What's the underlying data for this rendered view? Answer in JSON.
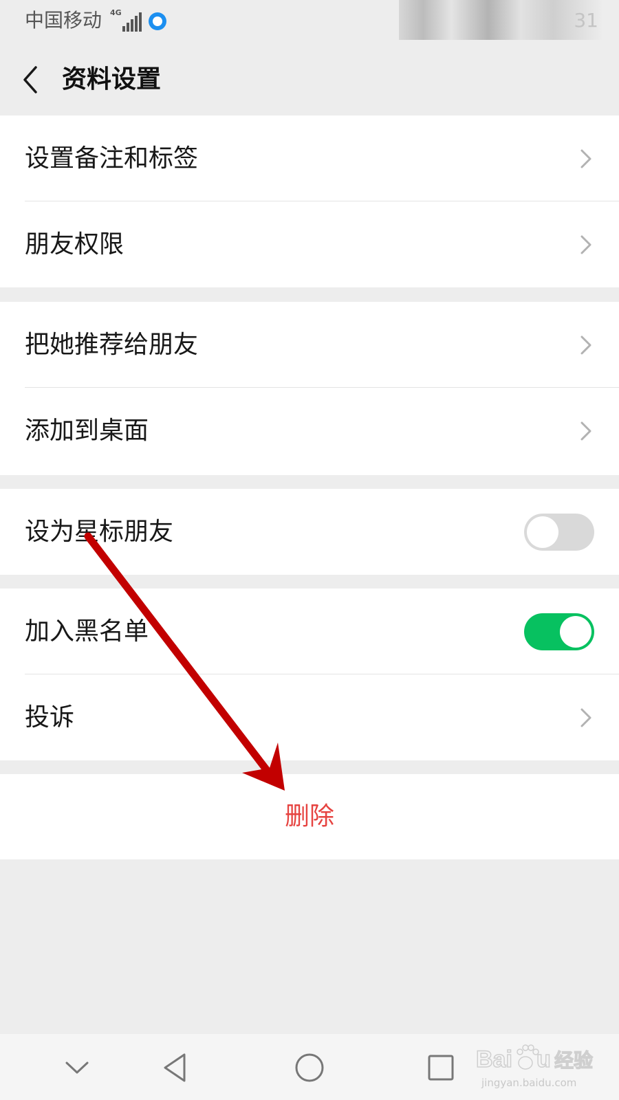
{
  "status_bar": {
    "carrier": "中国移动",
    "network_type": "4G",
    "clock_fragment": "31"
  },
  "header": {
    "back_icon": "chevron-left-icon",
    "title": "资料设置"
  },
  "groups": [
    {
      "items": [
        {
          "label": "设置备注和标签",
          "control": "chevron"
        },
        {
          "label": "朋友权限",
          "control": "chevron"
        }
      ]
    },
    {
      "items": [
        {
          "label": "把她推荐给朋友",
          "control": "chevron"
        },
        {
          "label": "添加到桌面",
          "control": "chevron"
        }
      ]
    },
    {
      "items": [
        {
          "label": "设为星标朋友",
          "control": "toggle",
          "checked": false
        }
      ]
    },
    {
      "items": [
        {
          "label": "加入黑名单",
          "control": "toggle",
          "checked": true
        },
        {
          "label": "投诉",
          "control": "chevron"
        }
      ]
    }
  ],
  "delete_button": {
    "label": "删除"
  },
  "colors": {
    "toggle_on": "#07c160",
    "toggle_off": "#d9d9d9",
    "delete_text": "#e64340",
    "annotation_arrow": "#c20000",
    "background": "#ededed"
  },
  "system_nav": {
    "buttons": [
      "chevron-down-icon",
      "back-triangle-icon",
      "home-circle-icon",
      "recents-square-icon"
    ]
  },
  "watermark": {
    "brand": "Baidu经验",
    "url": "jingyan.baidu.com"
  }
}
